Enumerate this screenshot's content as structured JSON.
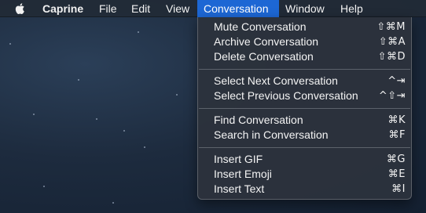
{
  "menubar": {
    "apple_icon": "apple-logo-icon",
    "app_name": "Caprine",
    "file": "File",
    "edit": "Edit",
    "view": "View",
    "conversation": "Conversation",
    "window": "Window",
    "help": "Help"
  },
  "menu": {
    "mute": {
      "label": "Mute Conversation",
      "shortcut": "⇧⌘M"
    },
    "archive": {
      "label": "Archive Conversation",
      "shortcut": "⇧⌘A"
    },
    "delete": {
      "label": "Delete Conversation",
      "shortcut": "⇧⌘D"
    },
    "select_next": {
      "label": "Select Next Conversation",
      "shortcut": "^⇥"
    },
    "select_prev": {
      "label": "Select Previous Conversation",
      "shortcut": "^⇧⇥"
    },
    "find": {
      "label": "Find Conversation",
      "shortcut": "⌘K"
    },
    "search": {
      "label": "Search in Conversation",
      "shortcut": "⌘F"
    },
    "insert_gif": {
      "label": "Insert GIF",
      "shortcut": "⌘G"
    },
    "insert_emoji": {
      "label": "Insert Emoji",
      "shortcut": "⌘E"
    },
    "insert_text": {
      "label": "Insert Text",
      "shortcut": "⌘I"
    }
  },
  "colors": {
    "highlight": "#1d67d4",
    "menu_background": "#2c323c",
    "desktop": "#1d2b3e"
  }
}
